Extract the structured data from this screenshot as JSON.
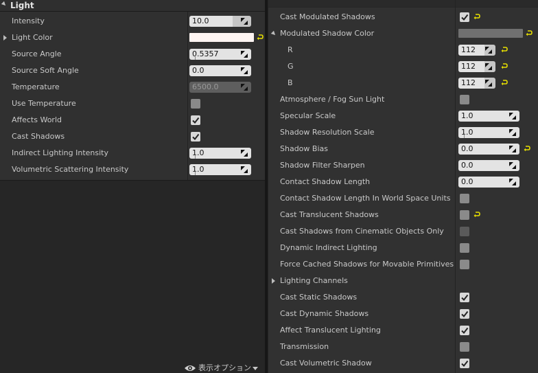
{
  "left": {
    "title": "Light",
    "rows": [
      {
        "id": "intensity",
        "label": "Intensity",
        "type": "num",
        "value": "10.0",
        "variant": "short"
      },
      {
        "id": "light-color",
        "label": "Light Color",
        "type": "color",
        "color": "#fff5f2",
        "expand": true,
        "reset": true
      },
      {
        "id": "source-angle",
        "label": "Source Angle",
        "type": "num",
        "value": "0.5357",
        "tick": true
      },
      {
        "id": "source-soft-angle",
        "label": "Source Soft Angle",
        "type": "num",
        "value": "0.0"
      },
      {
        "id": "temperature",
        "label": "Temperature",
        "type": "num",
        "value": "6500.0",
        "variant": "disabled"
      },
      {
        "id": "use-temperature",
        "label": "Use Temperature",
        "type": "check",
        "checked": false
      },
      {
        "id": "affects-world",
        "label": "Affects World",
        "type": "check",
        "checked": true
      },
      {
        "id": "cast-shadows",
        "label": "Cast Shadows",
        "type": "check",
        "checked": true
      },
      {
        "id": "indirect-lighting-intensity",
        "label": "Indirect Lighting Intensity",
        "type": "num",
        "value": "1.0",
        "tick": true
      },
      {
        "id": "volumetric-scattering-intensity",
        "label": "Volumetric Scattering Intensity",
        "type": "num",
        "value": "1.0",
        "tick": true
      }
    ],
    "display_options": {
      "label": "表示オプション"
    }
  },
  "right": {
    "rows": [
      {
        "id": "cast-modulated-shadows",
        "label": "Cast Modulated Shadows",
        "type": "check",
        "checked": true,
        "reset": true
      },
      {
        "id": "modulated-shadow-color",
        "label": "Modulated Shadow Color",
        "type": "color",
        "color": "#707070",
        "collapse": true,
        "reset": true
      },
      {
        "id": "r",
        "label": "R",
        "type": "smallnum",
        "value": "112",
        "sub": true,
        "reset": true
      },
      {
        "id": "g",
        "label": "G",
        "type": "smallnum",
        "value": "112",
        "sub": true,
        "reset": true
      },
      {
        "id": "b",
        "label": "B",
        "type": "smallnum",
        "value": "112",
        "sub": true,
        "reset": true
      },
      {
        "id": "atmosphere-fog-sun-light",
        "label": "Atmosphere / Fog Sun Light",
        "type": "check",
        "checked": false
      },
      {
        "id": "specular-scale",
        "label": "Specular Scale",
        "type": "num",
        "value": "1.0"
      },
      {
        "id": "shadow-resolution-scale",
        "label": "Shadow Resolution Scale",
        "type": "num",
        "value": "1.0",
        "tick": true
      },
      {
        "id": "shadow-bias",
        "label": "Shadow Bias",
        "type": "num",
        "value": "0.0",
        "reset": true
      },
      {
        "id": "shadow-filter-sharpen",
        "label": "Shadow Filter Sharpen",
        "type": "num",
        "value": "0.0"
      },
      {
        "id": "contact-shadow-length",
        "label": "Contact Shadow Length",
        "type": "num",
        "value": "0.0"
      },
      {
        "id": "contact-shadow-length-ws",
        "label": "Contact Shadow Length In World Space Units",
        "type": "check",
        "checked": false
      },
      {
        "id": "cast-translucent-shadows",
        "label": "Cast Translucent Shadows",
        "type": "check",
        "checked": false,
        "reset": true
      },
      {
        "id": "cast-shadows-cinematic",
        "label": "Cast Shadows from Cinematic Objects Only",
        "type": "check",
        "checked": false,
        "dim": true
      },
      {
        "id": "dynamic-indirect-lighting",
        "label": "Dynamic Indirect Lighting",
        "type": "check",
        "checked": false
      },
      {
        "id": "force-cached-shadows",
        "label": "Force Cached Shadows for Movable Primitives",
        "type": "check",
        "checked": false
      },
      {
        "id": "lighting-channels",
        "label": "Lighting Channels",
        "type": "none",
        "expand": true
      },
      {
        "id": "cast-static-shadows",
        "label": "Cast Static Shadows",
        "type": "check",
        "checked": true
      },
      {
        "id": "cast-dynamic-shadows",
        "label": "Cast Dynamic Shadows",
        "type": "check",
        "checked": true
      },
      {
        "id": "affect-translucent-lighting",
        "label": "Affect Translucent Lighting",
        "type": "check",
        "checked": true
      },
      {
        "id": "transmission",
        "label": "Transmission",
        "type": "check",
        "checked": false
      },
      {
        "id": "cast-volumetric-shadow",
        "label": "Cast Volumetric Shadow",
        "type": "check",
        "checked": true
      }
    ]
  },
  "colors": {
    "reset_arrow": "#e8e000",
    "panel": "#303030",
    "input": "#e3e3e3"
  }
}
